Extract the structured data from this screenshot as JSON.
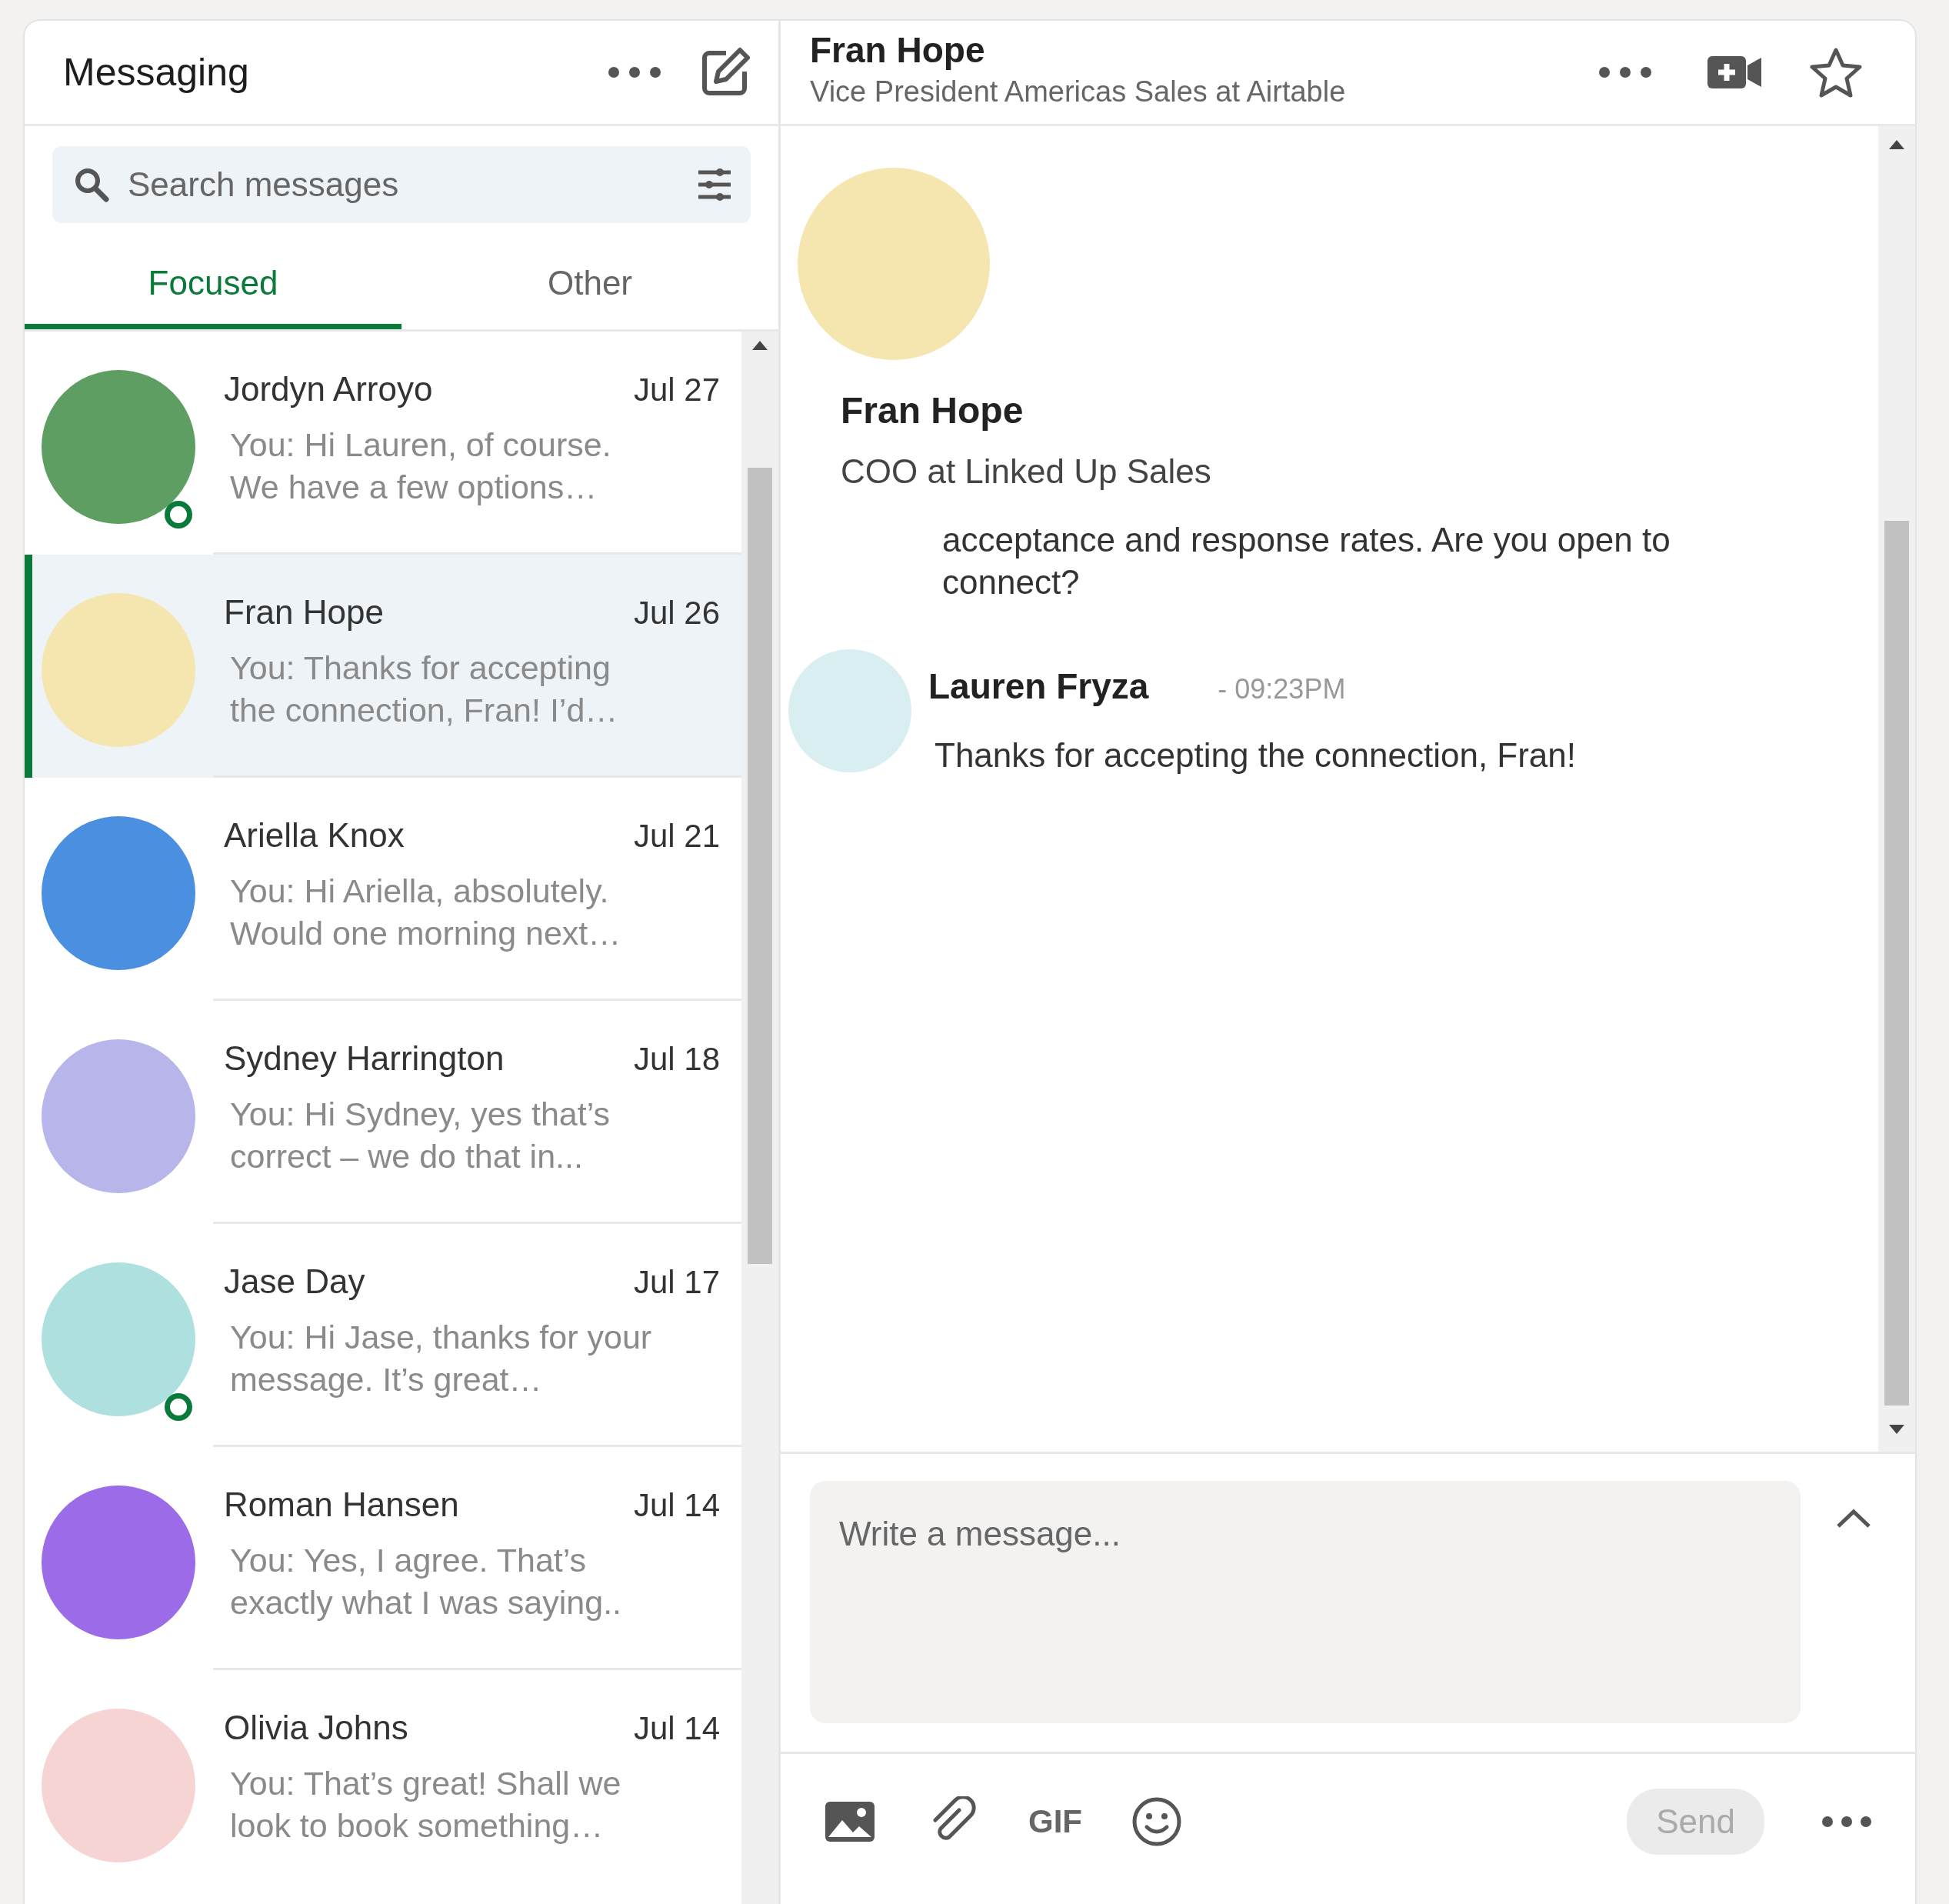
{
  "sidebar": {
    "title": "Messaging",
    "search": {
      "placeholder": "Search messages"
    },
    "tabs": [
      {
        "label": "Focused",
        "selected": true
      },
      {
        "label": "Other",
        "selected": false
      }
    ],
    "conversations": [
      {
        "name": "Jordyn Arroyo",
        "date": "Jul 27",
        "preview": "You: Hi Lauren, of course. We have a few options…",
        "selected": false,
        "online": true,
        "color": "#5e9e62"
      },
      {
        "name": "Fran Hope",
        "date": "Jul 26",
        "preview": "You: Thanks for accepting the connection, Fran! I’d…",
        "selected": true,
        "online": false,
        "color": "#f5e6b0"
      },
      {
        "name": "Ariella Knox",
        "date": "Jul 21",
        "preview": "You: Hi Ariella, absolutely. Would one morning next…",
        "selected": false,
        "online": false,
        "color": "#4a8fe0"
      },
      {
        "name": "Sydney Harrington",
        "date": "Jul 18",
        "preview": "You: Hi Sydney, yes that’s correct – we do that in...",
        "selected": false,
        "online": false,
        "color": "#b8b5ea"
      },
      {
        "name": "Jase Day",
        "date": "Jul 17",
        "preview": "You: Hi Jase, thanks for your message. It’s great…",
        "selected": false,
        "online": true,
        "color": "#aee0e0"
      },
      {
        "name": "Roman Hansen",
        "date": "Jul 14",
        "preview": "You: Yes, I agree. That’s exactly what I was saying..",
        "selected": false,
        "online": false,
        "color": "#9b6be8"
      },
      {
        "name": "Olivia Johns",
        "date": "Jul 14",
        "preview": "You: That’s great! Shall we look to book something…",
        "selected": false,
        "online": false,
        "color": "#f7d4d4"
      }
    ]
  },
  "conversation": {
    "header": {
      "name": "Fran Hope",
      "subtitle": "Vice President Americas Sales at Airtable"
    },
    "profile": {
      "name": "Fran Hope",
      "headline": "COO at Linked Up Sales",
      "color": "#f5e6b0"
    },
    "earlier_message": "acceptance and response rates. Are you open to connect?",
    "messages": [
      {
        "sender": "Lauren Fryza",
        "time": "- 09:23PM",
        "text": "Thanks for accepting the connection, Fran!",
        "color": "#d9eef0"
      }
    ]
  },
  "composer": {
    "placeholder": "Write a message...",
    "gif_label": "GIF",
    "send": {
      "label": "Send",
      "disabled": true
    }
  }
}
